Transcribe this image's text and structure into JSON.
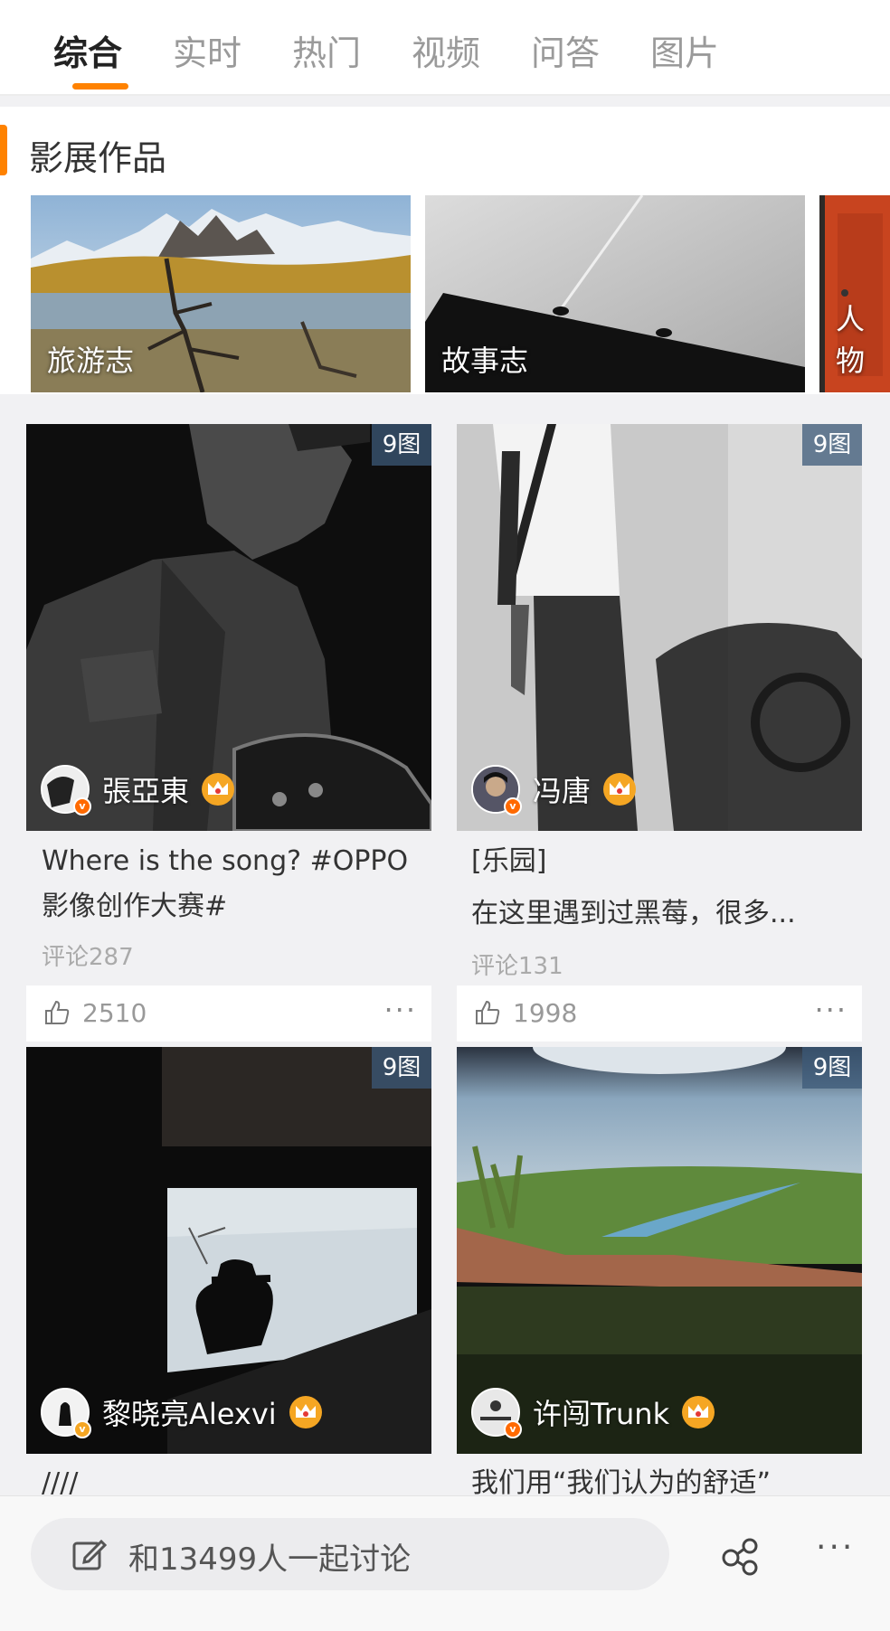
{
  "tabs": [
    "综合",
    "实时",
    "热门",
    "视频",
    "问答",
    "图片"
  ],
  "section": {
    "title": "影展作品"
  },
  "albums": [
    "旅游志",
    "故事志",
    "人物"
  ],
  "cards": [
    {
      "badge": "9图",
      "author": "張亞東",
      "text": "Where is the song? #OPPO影像创作大赛#",
      "comments": "评论287",
      "likes": "2510"
    },
    {
      "badge": "9图",
      "author": "冯唐",
      "text_line1": "[乐园]",
      "text_line2": "在这里遇到过黑莓，很多...",
      "comments": "评论131",
      "likes": "1998"
    },
    {
      "badge": "9图",
      "author": "黎晓亮Alexvi",
      "text": "////"
    },
    {
      "badge": "9图",
      "author": "许闯Trunk",
      "text": "我们用“我们认为的舒适”"
    }
  ],
  "bottom": {
    "discuss": "和13499人一起讨论"
  },
  "colors": {
    "accent": "#ff8200",
    "crown": "#f5a623"
  },
  "icons": [
    "crown-icon",
    "verified-icon",
    "like-icon",
    "more-icon",
    "edit-icon",
    "share-icon"
  ]
}
